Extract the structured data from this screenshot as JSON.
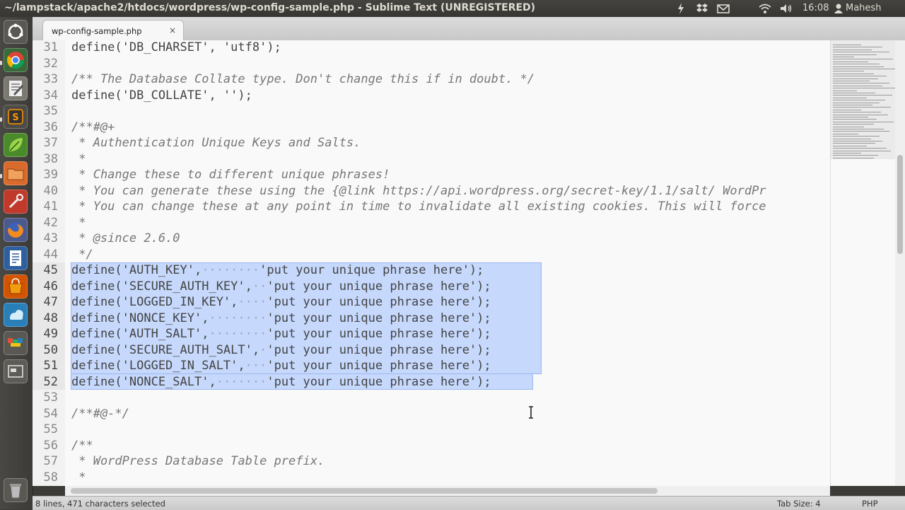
{
  "window": {
    "title": "~/lampstack/apache2/htdocs/wordpress/wp-config-sample.php - Sublime Text (UNREGISTERED)"
  },
  "tray": {
    "time": "16:08",
    "user": "Mahesh"
  },
  "launcher": {
    "apps": [
      "dash-home-icon",
      "chrome-icon",
      "text-editor-icon",
      "sublime-text-icon",
      "leaf-app-icon",
      "files-folder-icon",
      "settings-tools-icon",
      "firefox-icon",
      "document-writer-icon",
      "software-center-icon",
      "ubuntu-one-icon",
      "color-apps-icon",
      "workspace-switcher-icon",
      "trash-icon"
    ]
  },
  "tab": {
    "label": "wp-config-sample.php",
    "close": "×"
  },
  "editor": {
    "lines": [
      {
        "num": "31",
        "text": "define('DB_CHARSET', 'utf8');",
        "kind": "code"
      },
      {
        "num": "32",
        "text": "",
        "kind": "code"
      },
      {
        "num": "33",
        "text": "/** The Database Collate type. Don't change this if in doubt. */",
        "kind": "comment"
      },
      {
        "num": "34",
        "text": "define('DB_COLLATE', '');",
        "kind": "code"
      },
      {
        "num": "35",
        "text": "",
        "kind": "code"
      },
      {
        "num": "36",
        "text": "/**#@+",
        "kind": "comment"
      },
      {
        "num": "37",
        "text": " * Authentication Unique Keys and Salts.",
        "kind": "comment"
      },
      {
        "num": "38",
        "text": " *",
        "kind": "comment"
      },
      {
        "num": "39",
        "text": " * Change these to different unique phrases!",
        "kind": "comment"
      },
      {
        "num": "40",
        "text": " * You can generate these using the {@link https://api.wordpress.org/secret-key/1.1/salt/ WordPr",
        "kind": "comment"
      },
      {
        "num": "41",
        "text": " * You can change these at any point in time to invalidate all existing cookies. This will force",
        "kind": "comment"
      },
      {
        "num": "42",
        "text": " *",
        "kind": "comment"
      },
      {
        "num": "43",
        "text": " * @since 2.6.0",
        "kind": "comment"
      },
      {
        "num": "44",
        "text": " */",
        "kind": "comment"
      },
      {
        "num": "45",
        "text": "define('AUTH_KEY',········'put your unique phrase here');",
        "kind": "selected"
      },
      {
        "num": "46",
        "text": "define('SECURE_AUTH_KEY',··'put your unique phrase here');",
        "kind": "selected"
      },
      {
        "num": "47",
        "text": "define('LOGGED_IN_KEY',····'put your unique phrase here');",
        "kind": "selected"
      },
      {
        "num": "48",
        "text": "define('NONCE_KEY',········'put your unique phrase here');",
        "kind": "selected"
      },
      {
        "num": "49",
        "text": "define('AUTH_SALT',········'put your unique phrase here');",
        "kind": "selected"
      },
      {
        "num": "50",
        "text": "define('SECURE_AUTH_SALT',·'put your unique phrase here');",
        "kind": "selected"
      },
      {
        "num": "51",
        "text": "define('LOGGED_IN_SALT',···'put your unique phrase here');",
        "kind": "selected"
      },
      {
        "num": "52",
        "text": "define('NONCE_SALT',·······'put your unique phrase here');",
        "kind": "selected"
      },
      {
        "num": "53",
        "text": "",
        "kind": "code"
      },
      {
        "num": "54",
        "text": "/**#@-*/",
        "kind": "comment"
      },
      {
        "num": "55",
        "text": "",
        "kind": "code"
      },
      {
        "num": "56",
        "text": "/**",
        "kind": "comment"
      },
      {
        "num": "57",
        "text": " * WordPress Database Table prefix.",
        "kind": "comment"
      },
      {
        "num": "58",
        "text": " *",
        "kind": "comment"
      }
    ]
  },
  "status": {
    "selection": "8 lines, 471 characters selected",
    "tab_size": "Tab Size: 4",
    "syntax": "PHP"
  },
  "colors": {
    "selection": "#c6d8fc",
    "editor_bg": "#f9f9f9",
    "comment": "#777777"
  }
}
